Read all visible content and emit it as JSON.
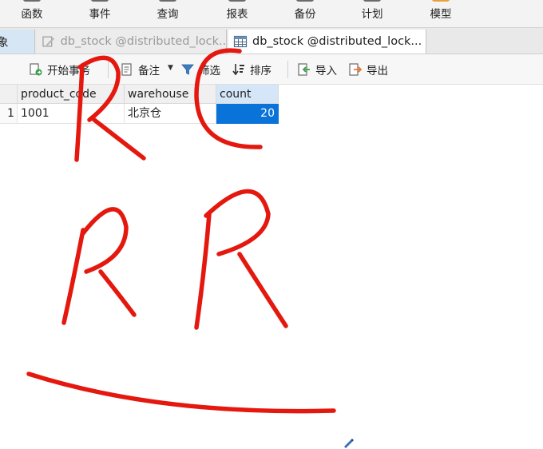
{
  "menu": {
    "items": [
      {
        "label": "函数"
      },
      {
        "label": "事件"
      },
      {
        "label": "查询"
      },
      {
        "label": "报表"
      },
      {
        "label": "备份"
      },
      {
        "label": "计划"
      },
      {
        "label": "模型"
      }
    ]
  },
  "tabs": {
    "objects_label": "象",
    "tab1_label": "db_stock @distributed_lock...",
    "tab2_label": "db_stock @distributed_lock..."
  },
  "toolbar": {
    "begin_transaction": "开始事务",
    "note": "备注",
    "filter": "筛选",
    "sort": "排序",
    "import": "导入",
    "export": "导出"
  },
  "grid": {
    "columns": [
      "product_code",
      "warehouse",
      "count"
    ],
    "rows": [
      {
        "rownum": "1",
        "product_code": "1001",
        "warehouse": "北京仓",
        "count": "20"
      }
    ]
  },
  "colors": {
    "selection": "#0a73d9",
    "ink": "#e4180e"
  }
}
